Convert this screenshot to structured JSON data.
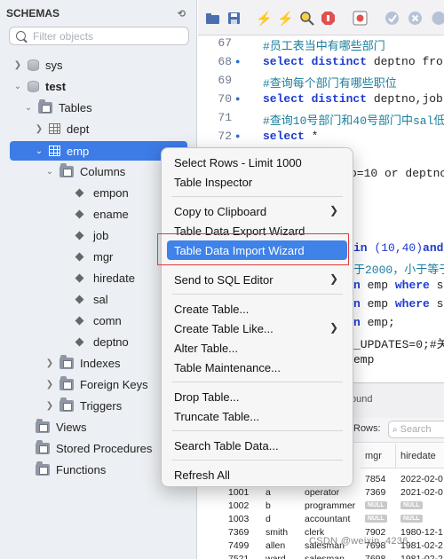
{
  "colors": {
    "accent": "#3d7be6",
    "menu_highlight": "#3f82e8",
    "annotation_box": "#e03a3a",
    "keyword": "#1f3bd1",
    "comment": "#1a7f9c"
  },
  "schemas": {
    "title": "SCHEMAS",
    "filter_placeholder": "Filter objects",
    "tree": {
      "sys": "sys",
      "test": "test",
      "tables": "Tables",
      "dept": "dept",
      "emp": "emp",
      "columns": "Columns",
      "column_items": [
        "empon",
        "ename",
        "job",
        "mgr",
        "hiredate",
        "sal",
        "comn",
        "deptno"
      ],
      "indexes": "Indexes",
      "foreign_keys": "Foreign Keys",
      "triggers": "Triggers",
      "views": "Views",
      "stored_procedures": "Stored Procedures",
      "functions": "Functions"
    }
  },
  "toolbar_icons": [
    "folder-icon",
    "save-icon",
    "lightning-icon",
    "lightning-cursor-icon",
    "explain-icon",
    "stop-icon",
    "toggle-icon",
    "commit-icon",
    "rollback-icon"
  ],
  "editor": {
    "lines": [
      {
        "n": "67",
        "bp": false,
        "text": "#员工表当中有哪些部门"
      },
      {
        "n": "68",
        "bp": true,
        "kw": "select distinct",
        "rest": " deptno fro"
      },
      {
        "n": "69",
        "bp": false,
        "text": "#查询每个部门有哪些职位"
      },
      {
        "n": "70",
        "bp": true,
        "kw": "select distinct",
        "rest": " deptno,job"
      },
      {
        "n": "71",
        "bp": false,
        "text": "#查询10号部门和40号部门中sal低"
      },
      {
        "n": "72",
        "bp": true,
        "kw": "select",
        "rest": " *"
      }
    ],
    "visible_fragments": {
      "line73": "o=10 or deptno",
      "line76_a": "in",
      "line76_b": "(10,40)",
      "line76_c": "and",
      "line77": "于2000，小于等于",
      "line78_a": "emp",
      "line78_b": "where",
      "line78_c": "sa",
      "line79_a": "emp",
      "line79_b": "where",
      "line79_c": "sa",
      "line80": "emp;",
      "line81": "_UPDATES=0;#关闭",
      "line82": "emp"
    }
  },
  "result": {
    "tab_fragment": "ound",
    "rows_label": "Rows:",
    "search_placeholder": "Search",
    "columns": [
      "mgr",
      "hiredate"
    ],
    "rows": [
      {
        "id": "",
        "name": "",
        "job": "",
        "mgr": "7854",
        "hiredate": "2022-02-0",
        "mgr_null": false,
        "hd_null": false
      },
      {
        "id": "1001",
        "name": "a",
        "job": "operator",
        "mgr": "7369",
        "hiredate": "2021-02-0",
        "mgr_null": false,
        "hd_null": false
      },
      {
        "id": "1002",
        "name": "b",
        "job": "programmer",
        "mgr": "NULL",
        "hiredate": "NULL",
        "mgr_null": true,
        "hd_null": true
      },
      {
        "id": "1003",
        "name": "d",
        "job": "accountant",
        "mgr": "NULL",
        "hiredate": "NULL",
        "mgr_null": true,
        "hd_null": true
      },
      {
        "id": "7369",
        "name": "smith",
        "job": "clerk",
        "mgr": "7902",
        "hiredate": "1980-12-1",
        "mgr_null": false,
        "hd_null": false
      },
      {
        "id": "7499",
        "name": "allen",
        "job": "salesman",
        "mgr": "7698",
        "hiredate": "1981-02-2",
        "mgr_null": false,
        "hd_null": false
      },
      {
        "id": "7521",
        "name": "ward",
        "job": "salesman",
        "mgr": "7698",
        "hiredate": "1981-02-2",
        "mgr_null": false,
        "hd_null": false
      }
    ]
  },
  "context_menu": {
    "items": [
      {
        "label": "Select Rows - Limit 1000",
        "submenu": false
      },
      {
        "label": "Table Inspector",
        "submenu": false
      },
      {
        "label": "Copy to Clipboard",
        "submenu": true
      },
      {
        "label": "Table Data Export Wizard",
        "submenu": false
      },
      {
        "label": "Table Data Import Wizard",
        "submenu": false,
        "highlighted": true
      },
      {
        "label": "Send to SQL Editor",
        "submenu": true
      },
      {
        "label": "Create Table...",
        "submenu": false
      },
      {
        "label": "Create Table Like...",
        "submenu": true
      },
      {
        "label": "Alter Table...",
        "submenu": false
      },
      {
        "label": "Table Maintenance...",
        "submenu": false
      },
      {
        "label": "Drop Table...",
        "submenu": false
      },
      {
        "label": "Truncate Table...",
        "submenu": false
      },
      {
        "label": "Search Table Data...",
        "submenu": false
      },
      {
        "label": "Refresh All",
        "submenu": false
      }
    ]
  },
  "watermark": "CSDN @weixin_4236..."
}
